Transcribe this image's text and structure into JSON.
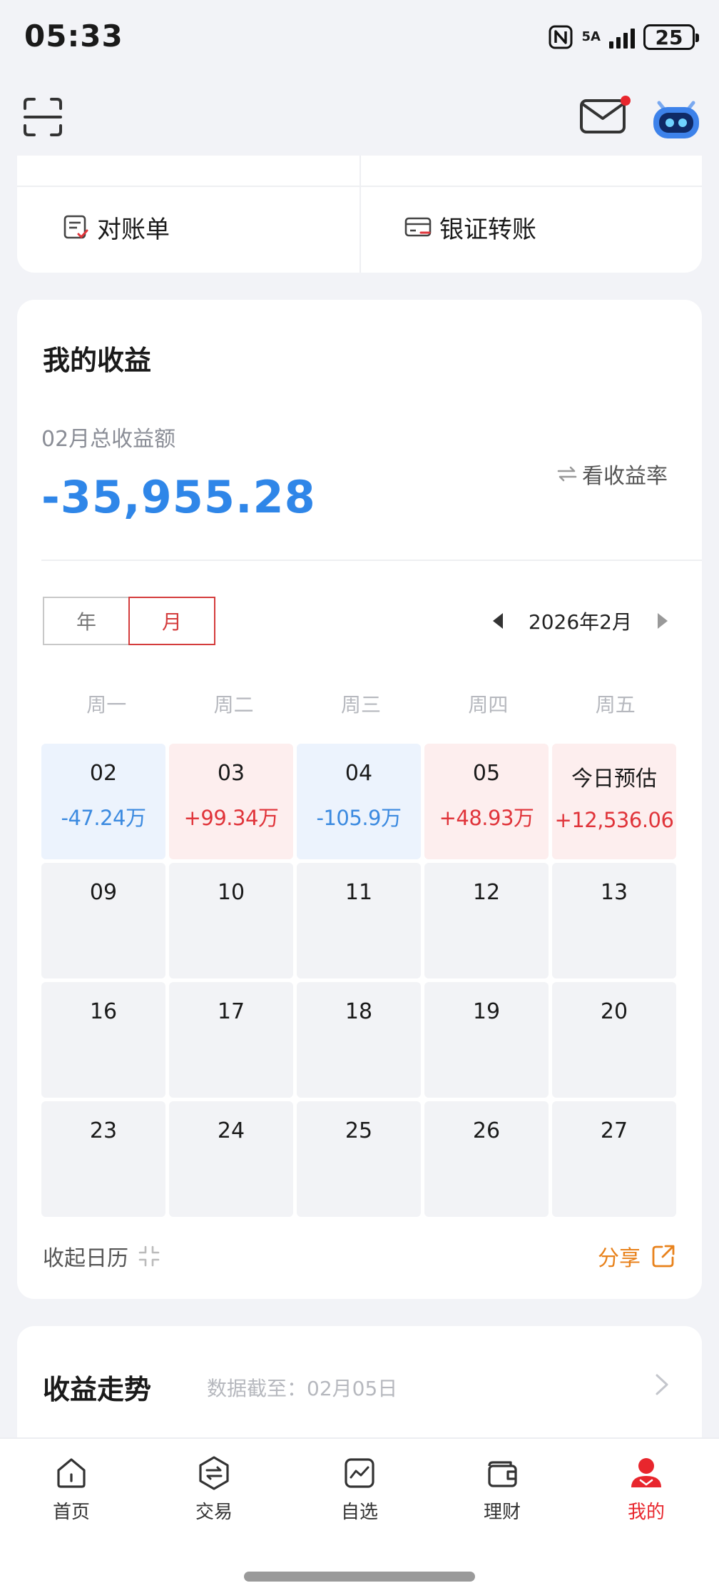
{
  "status_bar": {
    "time": "05:33",
    "network": "5A",
    "battery": "25"
  },
  "quick_tools": {
    "statement": "对账单",
    "bank_transfer": "银证转账"
  },
  "earnings": {
    "title": "我的收益",
    "month_label": "02月总收益额",
    "total": "-35,955.28",
    "view_rate": "看收益率",
    "tabs": {
      "year": "年",
      "month": "月"
    },
    "period": "2026年2月",
    "weekdays": [
      "周一",
      "周二",
      "周三",
      "周四",
      "周五"
    ],
    "days": [
      {
        "day": "02",
        "value": "-47.24万",
        "tone": "neg"
      },
      {
        "day": "03",
        "value": "+99.34万",
        "tone": "pos"
      },
      {
        "day": "04",
        "value": "-105.9万",
        "tone": "neg"
      },
      {
        "day": "05",
        "value": "+48.93万",
        "tone": "pos"
      },
      {
        "day": "今日预估",
        "value": "+12,536.06",
        "tone": "pos"
      },
      {
        "day": "09",
        "value": "",
        "tone": "none"
      },
      {
        "day": "10",
        "value": "",
        "tone": "none"
      },
      {
        "day": "11",
        "value": "",
        "tone": "none"
      },
      {
        "day": "12",
        "value": "",
        "tone": "none"
      },
      {
        "day": "13",
        "value": "",
        "tone": "none"
      },
      {
        "day": "16",
        "value": "",
        "tone": "none"
      },
      {
        "day": "17",
        "value": "",
        "tone": "none"
      },
      {
        "day": "18",
        "value": "",
        "tone": "none"
      },
      {
        "day": "19",
        "value": "",
        "tone": "none"
      },
      {
        "day": "20",
        "value": "",
        "tone": "none"
      },
      {
        "day": "23",
        "value": "",
        "tone": "none"
      },
      {
        "day": "24",
        "value": "",
        "tone": "none"
      },
      {
        "day": "25",
        "value": "",
        "tone": "none"
      },
      {
        "day": "26",
        "value": "",
        "tone": "none"
      },
      {
        "day": "27",
        "value": "",
        "tone": "none"
      }
    ],
    "collapse": "收起日历",
    "share": "分享"
  },
  "trend": {
    "title": "收益走势",
    "subtitle": "数据截至：02月05日"
  },
  "nav": {
    "home": "首页",
    "trade": "交易",
    "watchlist": "自选",
    "wealth": "理财",
    "mine": "我的"
  },
  "colors": {
    "negative": "#3b8ae0",
    "positive": "#e0343a",
    "accent": "#e8262d",
    "share": "#e8821c"
  }
}
